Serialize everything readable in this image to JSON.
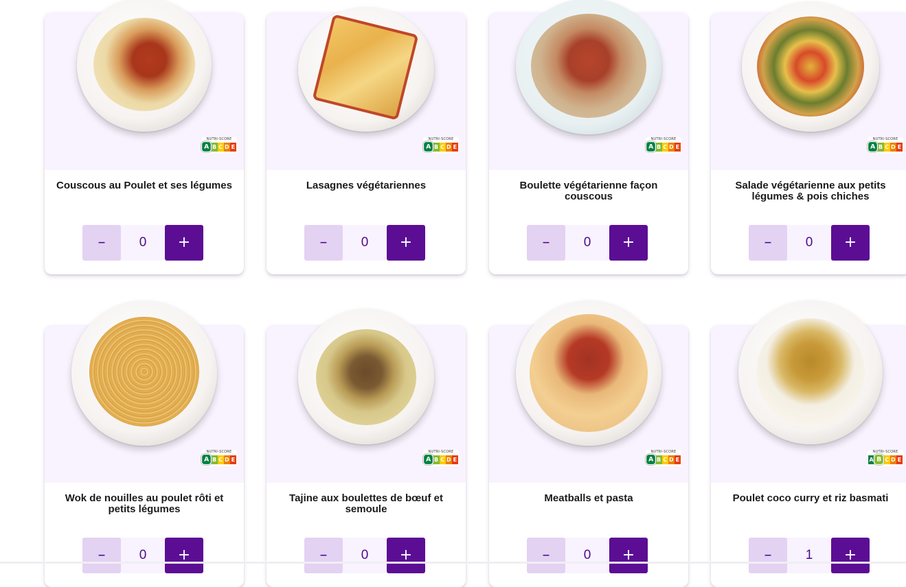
{
  "nutri_score_label": "NUTRI-SCORE",
  "nutri_letters": [
    "A",
    "B",
    "C",
    "D",
    "E"
  ],
  "nutri_colors": [
    "#038141",
    "#85bb2f",
    "#fecb02",
    "#ee8100",
    "#e63e11"
  ],
  "colors": {
    "card_top_bg": "#f8f3fe",
    "minus_button_bg": "#e3d2f2",
    "plus_button_bg": "#5b0d94",
    "quantity_text": "#4d0a8c"
  },
  "minus_label": "–",
  "plus_label": "+",
  "products": [
    {
      "name": "Couscous au Poulet et ses légumes",
      "quantity": "0",
      "nutri_score": "A",
      "food": "couscous-chicken"
    },
    {
      "name": "Lasagnes végétariennes",
      "quantity": "0",
      "nutri_score": "A",
      "food": "lasagna"
    },
    {
      "name": "Boulette végétarienne façon couscous",
      "quantity": "0",
      "nutri_score": "A",
      "food": "veg-meatballs-couscous"
    },
    {
      "name": "Salade végétarienne aux petits légumes & pois chiches",
      "quantity": "0",
      "nutri_score": "A",
      "food": "chickpea-salad"
    },
    {
      "name": "Wok de nouilles au poulet rôti et petits légumes",
      "quantity": "0",
      "nutri_score": "A",
      "food": "noodles-wok"
    },
    {
      "name": "Tajine aux boulettes de bœuf et semoule",
      "quantity": "0",
      "nutri_score": "A",
      "food": "tajine"
    },
    {
      "name": "Meatballs et pasta",
      "quantity": "0",
      "nutri_score": "A",
      "food": "meatballs-pasta"
    },
    {
      "name": "Poulet coco curry et riz basmati",
      "quantity": "1",
      "nutri_score": "B",
      "food": "coconut-curry-rice"
    }
  ]
}
